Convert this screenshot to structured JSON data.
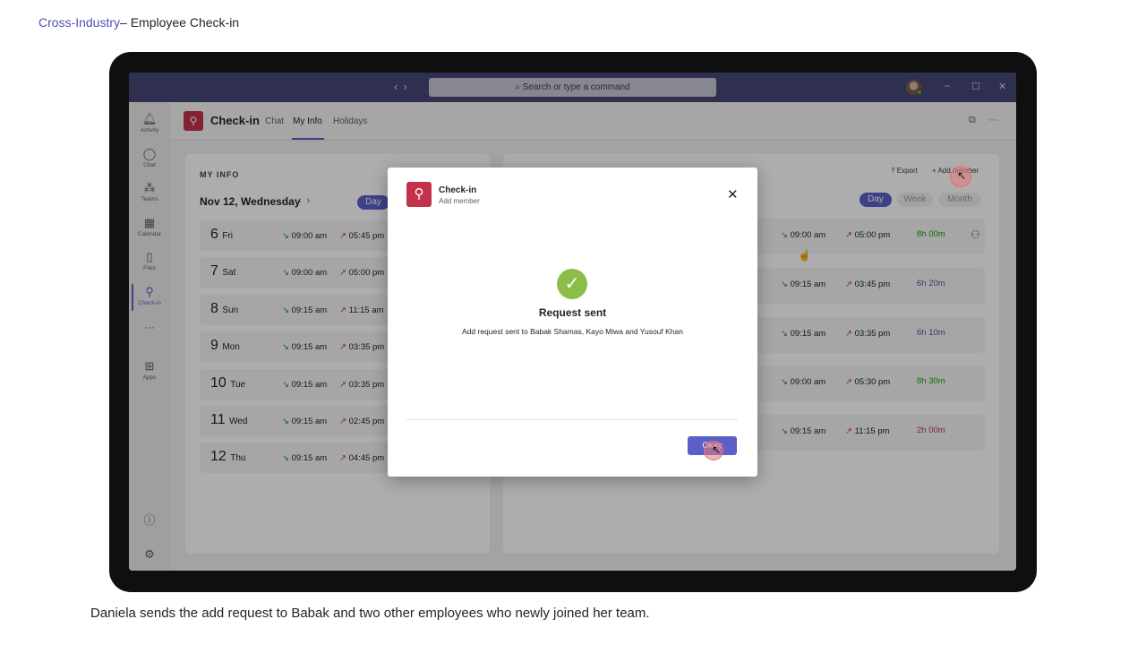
{
  "slide": {
    "title_link": "Cross-Industry",
    "title_rest": "– Employee Check-in",
    "caption": "Daniela sends the add request to Babak and two other employees who newly joined her team."
  },
  "titlebar": {
    "search_placeholder": "Search or type a command",
    "minimize": "–",
    "maximize": "☐",
    "close": "✕"
  },
  "rail": {
    "items": [
      {
        "label": "Activity",
        "icon": "bell-icon"
      },
      {
        "label": "Chat",
        "icon": "chat-icon"
      },
      {
        "label": "Teams",
        "icon": "teams-icon"
      },
      {
        "label": "Calendar",
        "icon": "calendar-icon"
      },
      {
        "label": "Files",
        "icon": "file-icon"
      },
      {
        "label": "Check-in",
        "icon": "checkin-icon"
      },
      {
        "label": "Apps",
        "icon": "apps-icon"
      }
    ],
    "more": "···"
  },
  "app": {
    "name": "Check-in",
    "tabs": [
      "Chat",
      "My Info",
      "Holidays"
    ],
    "active_tab": "My Info"
  },
  "my_info": {
    "label": "MY INFO",
    "date": "Nov 12, Wednesday",
    "view_day": "Day",
    "rows": [
      {
        "num": "6",
        "day": "Fri",
        "in": "09:00 am",
        "out": "05:45 pm"
      },
      {
        "num": "7",
        "day": "Sat",
        "in": "09:00 am",
        "out": "05:00 pm"
      },
      {
        "num": "8",
        "day": "Sun",
        "in": "09:15 am",
        "out": "11:15 am"
      },
      {
        "num": "9",
        "day": "Mon",
        "in": "09:15 am",
        "out": "03:35 pm"
      },
      {
        "num": "10",
        "day": "Tue",
        "in": "09:15 am",
        "out": "03:35 pm"
      },
      {
        "num": "11",
        "day": "Wed",
        "in": "09:15 am",
        "out": "02:45 pm"
      },
      {
        "num": "12",
        "day": "Thu",
        "in": "09:15 am",
        "out": "04:45 pm"
      }
    ]
  },
  "team": {
    "export": "Export",
    "add_member": "+ Add member",
    "views": [
      "Day",
      "Week",
      "Month"
    ],
    "active_view": "Day",
    "rows": [
      {
        "in": "09:00 am",
        "out": "05:00 pm",
        "duration": "8h 00m",
        "color": "#13a10e"
      },
      {
        "in": "09:15 am",
        "out": "03:45 pm",
        "duration": "6h 20m",
        "color": "#4f52b2"
      },
      {
        "in": "09:15 am",
        "out": "03:35 pm",
        "duration": "6h 10m",
        "color": "#4f52b2"
      },
      {
        "in": "09:00 am",
        "out": "05:30 pm",
        "duration": "8h 30m",
        "color": "#13a10e"
      },
      {
        "in": "09:15 am",
        "out": "11:15 pm",
        "duration": "2h 00m",
        "color": "#c4314b"
      }
    ]
  },
  "dialog": {
    "title": "Check-in",
    "subtitle": "Add member",
    "heading": "Request sent",
    "message": "Add request sent to Babak Shamas, Kayo Miwa and Yusouf Khan",
    "button": "Okay"
  }
}
